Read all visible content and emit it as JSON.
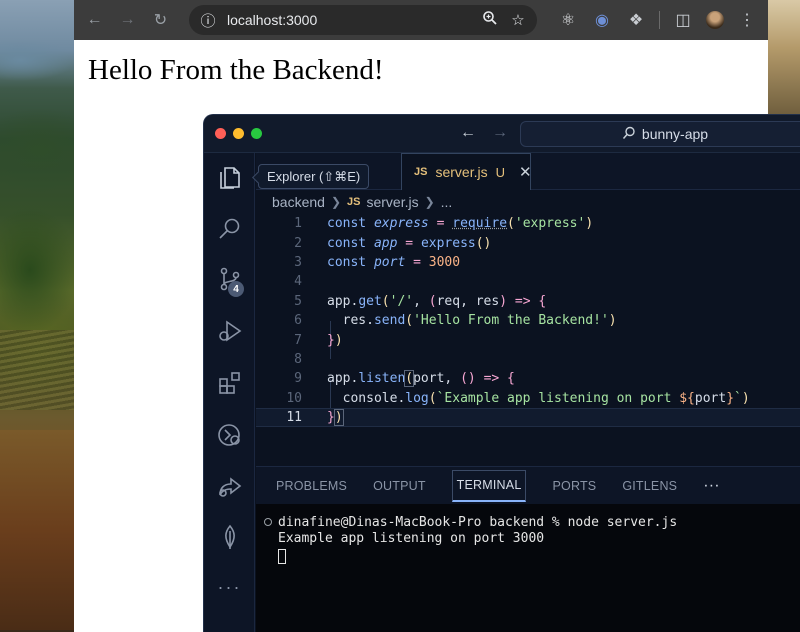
{
  "browser": {
    "url": "localhost:3000",
    "page_heading": "Hello From the Backend!"
  },
  "vscode": {
    "command_center": "bunny-app",
    "tooltip": "Explorer (⇧⌘E)",
    "source_control_badge": "4",
    "tab": {
      "lang": "JS",
      "filename": "server.js",
      "status": "U"
    },
    "breadcrumb": {
      "folder": "backend",
      "lang": "JS",
      "file": "server.js",
      "more": "..."
    },
    "line_numbers": [
      "1",
      "2",
      "3",
      "4",
      "5",
      "6",
      "7",
      "8",
      "9",
      "10",
      "11"
    ],
    "panel_tabs": [
      "PROBLEMS",
      "OUTPUT",
      "TERMINAL",
      "PORTS",
      "GITLENS"
    ],
    "panel_more": "···",
    "terminal": {
      "prompt": "dinafine@Dinas-MacBook-Pro backend % node server.js",
      "output": "Example app listening on port 3000"
    }
  }
}
